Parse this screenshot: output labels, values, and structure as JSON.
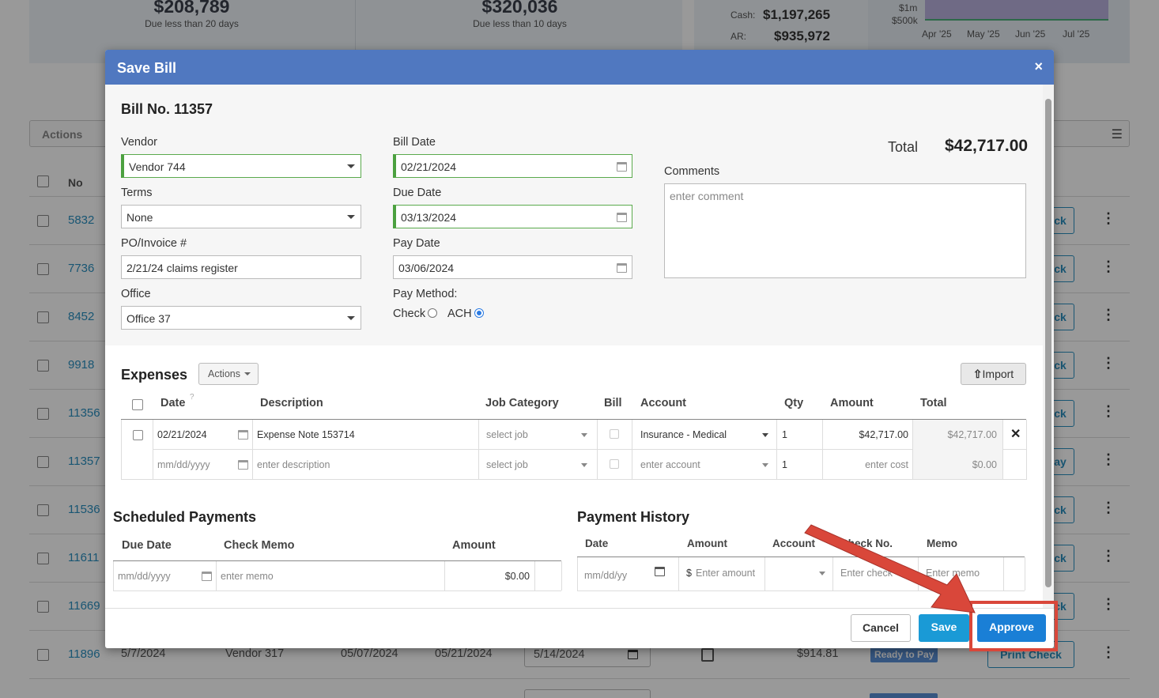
{
  "background": {
    "summary": {
      "card1": {
        "amount": "$208,789",
        "label": "Due less than 20 days"
      },
      "card2": {
        "amount": "$320,036",
        "label": "Due less than 10 days"
      },
      "cash_label": "Cash:",
      "cash_value": "$1,197,265",
      "ar_label": "AR:",
      "ar_value": "$935,972",
      "chart_y1": "$1m",
      "chart_y2": "$500k",
      "months": [
        "Apr '25",
        "May '25",
        "Jun '25",
        "Jul '25"
      ]
    },
    "actions_label": "Actions",
    "no_header": "No",
    "rows": [
      {
        "no": "5832",
        "btn": "ck"
      },
      {
        "no": "7736",
        "btn": "ck"
      },
      {
        "no": "8452",
        "btn": "ck"
      },
      {
        "no": "9918",
        "btn": "ck"
      },
      {
        "no": "11356",
        "btn": "ck"
      },
      {
        "no": "11357",
        "btn": "ay"
      },
      {
        "no": "11536",
        "btn": "ck"
      },
      {
        "no": "11611",
        "btn": "ck"
      },
      {
        "no": "11669",
        "btn": "ck"
      }
    ],
    "last_row": {
      "no": "11896",
      "date": "5/7/2024",
      "vendor": "Vendor 317",
      "bill_date": "05/07/2024",
      "due_date": "05/21/2024",
      "pay_date": "5/14/2024",
      "amount": "$914.81",
      "status": "Ready to Pay",
      "action": "Print Check"
    }
  },
  "modal": {
    "title": "Save Bill",
    "close": "×",
    "bill_no": "Bill No. 11357",
    "total_label": "Total",
    "total_value": "$42,717.00",
    "vendor": {
      "label": "Vendor",
      "value": "Vendor 744"
    },
    "terms": {
      "label": "Terms",
      "value": "None"
    },
    "po": {
      "label": "PO/Invoice #",
      "value": "2/21/24 claims register"
    },
    "office": {
      "label": "Office",
      "value": "Office 37"
    },
    "bill_date": {
      "label": "Bill Date",
      "value": "02/21/2024"
    },
    "due_date": {
      "label": "Due Date",
      "value": "03/13/2024"
    },
    "pay_date": {
      "label": "Pay Date",
      "value": "03/06/2024"
    },
    "pay_method": {
      "label": "Pay Method:",
      "check": "Check",
      "ach": "ACH",
      "selected": "ACH"
    },
    "comments": {
      "label": "Comments",
      "placeholder": "enter comment"
    },
    "expenses": {
      "title": "Expenses",
      "actions": "Actions",
      "import": "Import",
      "headers": [
        "Date",
        "Description",
        "Job Category",
        "Bill",
        "Account",
        "Qty",
        "Amount",
        "Total"
      ],
      "date_help": "?",
      "rows": [
        {
          "date": "02/21/2024",
          "description": "Expense Note 153714",
          "job": "select job",
          "account": "Insurance - Medical",
          "qty": "1",
          "amount": "$42,717.00",
          "total": "$42,717.00"
        },
        {
          "date": "mm/dd/yyyy",
          "description": "enter description",
          "job": "select job",
          "account": "enter account",
          "qty": "1",
          "amount": "enter cost",
          "total": "$0.00"
        }
      ]
    },
    "scheduled": {
      "title": "Scheduled Payments",
      "headers": [
        "Due Date",
        "Check Memo",
        "Amount"
      ],
      "row": {
        "date": "mm/dd/yyyy",
        "memo": "enter memo",
        "amount": "$0.00"
      }
    },
    "history": {
      "title": "Payment History",
      "headers": [
        "Date",
        "Amount",
        "Account",
        "Check No.",
        "Memo"
      ],
      "row": {
        "date": "mm/dd/yy",
        "currency": "$",
        "amount": "Enter amount",
        "check": "Enter check",
        "memo": "Enter memo"
      }
    },
    "buttons": {
      "cancel": "Cancel",
      "save": "Save",
      "approve": "Approve"
    }
  },
  "colors": {
    "header": "#5078c0",
    "primary": "#1a9ad6",
    "approve": "#1a7fd6",
    "highlight": "#d9473a",
    "valid_green": "#4ca140"
  }
}
